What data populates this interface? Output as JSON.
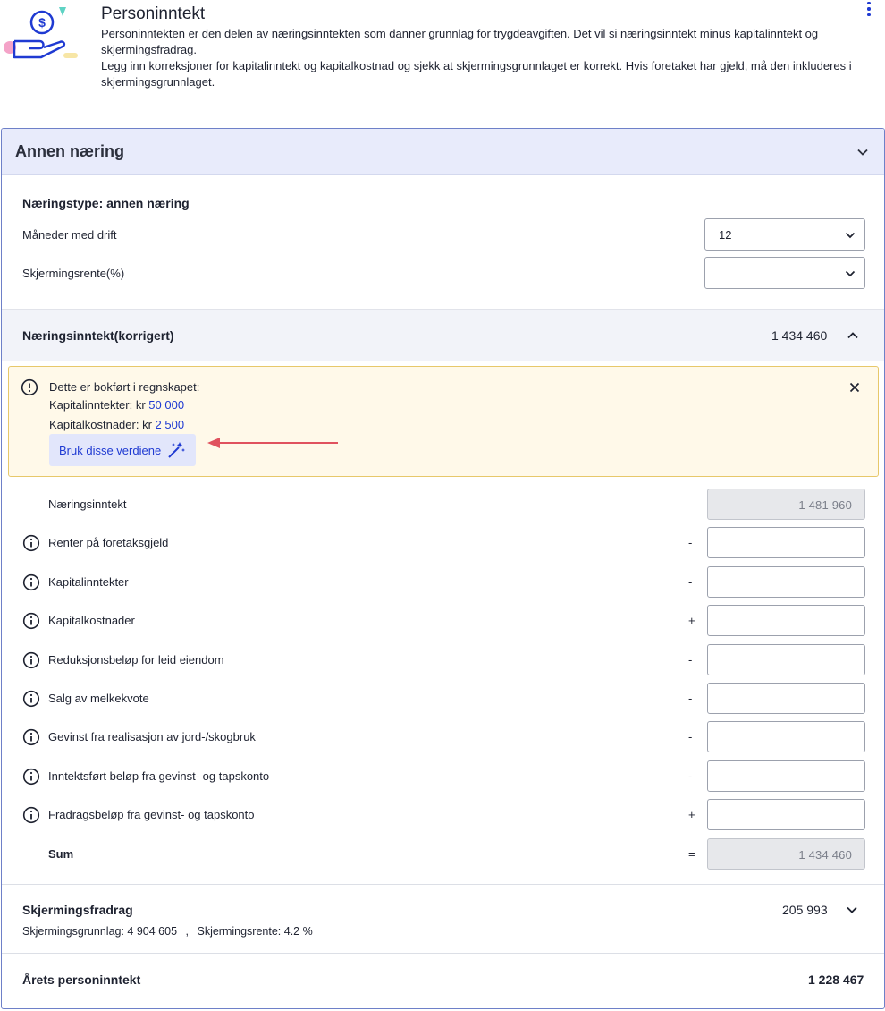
{
  "header": {
    "title": "Personinntekt",
    "desc_line1": "Personinntekten er den delen av næringsinntekten som danner grunnlag for trygdeavgiften. Det vil si næringsinntekt minus kapitalinntekt og skjermingsfradrag.",
    "desc_line2": "Legg inn korreksjoner for kapitalinntekt og kapitalkostnad og sjekk at skjermingsgrunnlaget er korrekt. Hvis foretaket har gjeld, må den inkluderes i skjermingsgrunnlaget.",
    "menu_icon": "more-vertical-icon",
    "illustration_icon": "hand-with-coin-illustration"
  },
  "card": {
    "title": "Annen næring",
    "naeringstype": "Næringstype: annen næring",
    "maaneder_label": "Måneder med drift",
    "maaneder_value": "12",
    "rente_label": "Skjermingsrente(%)",
    "rente_value": ""
  },
  "naeringsinntekt_section": {
    "title": "Næringsinntekt(korrigert)",
    "total": "1 434 460"
  },
  "alert": {
    "heading": "Dette er bokført i regnskapet:",
    "kapitalinntekter_prefix": "Kapitalinntekter: kr ",
    "kapitalinntekter_value": "50 000",
    "kapitalkostnader_prefix": "Kapitalkostnader: kr ",
    "kapitalkostnader_value": "2 500",
    "button_label": "Bruk disse verdiene"
  },
  "rows": [
    {
      "label": "Næringsinntekt",
      "op": "",
      "value": "1 481 960",
      "readonly": true,
      "info": false
    },
    {
      "label": "Renter på foretaksgjeld",
      "op": "-",
      "value": "",
      "readonly": false,
      "info": true
    },
    {
      "label": "Kapitalinntekter",
      "op": "-",
      "value": "",
      "readonly": false,
      "info": true
    },
    {
      "label": "Kapitalkostnader",
      "op": "+",
      "value": "",
      "readonly": false,
      "info": true
    },
    {
      "label": "Reduksjonsbeløp for leid eiendom",
      "op": "-",
      "value": "",
      "readonly": false,
      "info": true
    },
    {
      "label": "Salg av melkekvote",
      "op": "-",
      "value": "",
      "readonly": false,
      "info": true
    },
    {
      "label": "Gevinst fra realisasjon av jord-/skogbruk",
      "op": "-",
      "value": "",
      "readonly": false,
      "info": true
    },
    {
      "label": "Inntektsført beløp fra gevinst- og tapskonto",
      "op": "-",
      "value": "",
      "readonly": false,
      "info": true
    },
    {
      "label": "Fradragsbeløp fra gevinst- og tapskonto",
      "op": "+",
      "value": "",
      "readonly": false,
      "info": true
    },
    {
      "label": "Sum",
      "op": "=",
      "value": "1 434 460",
      "readonly": true,
      "info": false
    }
  ],
  "skjerming": {
    "title": "Skjermingsfradrag",
    "value": "205 993",
    "grunnlag": "Skjermingsgrunnlag: 4 904 605",
    "separator": ",",
    "rente": "Skjermingsrente: 4.2 %"
  },
  "aarets": {
    "title": "Årets personinntekt",
    "value": "1 228 467"
  },
  "colors": {
    "accent": "#1f3ad2",
    "header_bg": "#e8ebfb",
    "alert_bg": "#fff9e9",
    "alert_border": "#e7c86a",
    "arrow": "#e0525e"
  }
}
